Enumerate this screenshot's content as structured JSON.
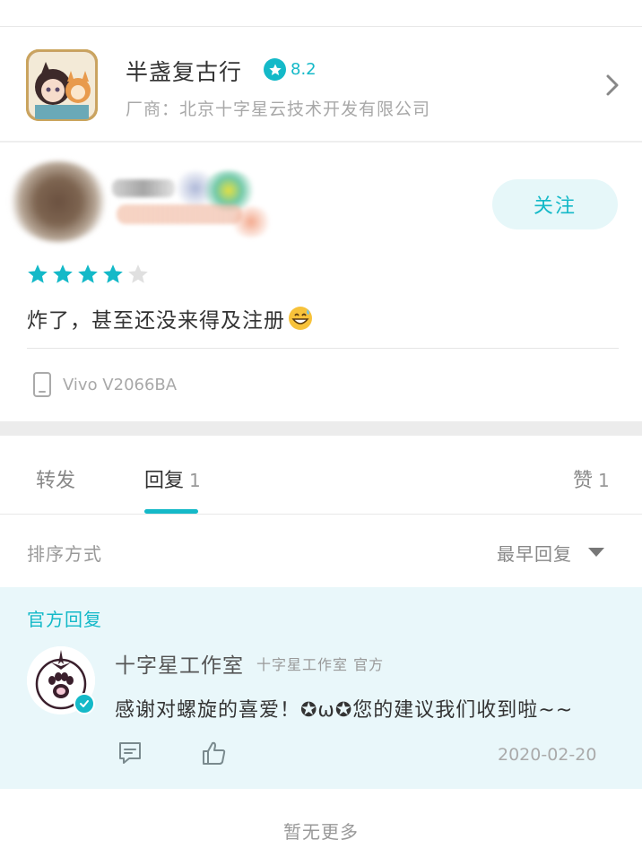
{
  "game": {
    "title": "半盏复古行",
    "rating": "8.2",
    "vendor": "厂商：北京十字星云技术开发有限公司",
    "icon": "game-avatar-icon"
  },
  "reviewer": {
    "follow_label": "关注",
    "stars_filled": 4,
    "stars_total": 5,
    "review_text": "炸了，甚至还没来得及注册",
    "emoji": "grinning-sweat-emoji"
  },
  "device": {
    "icon": "phone-icon",
    "label": "Vivo V2066BA"
  },
  "tabs": [
    {
      "label": "转发",
      "count": ""
    },
    {
      "label": "回复",
      "count": "1"
    },
    {
      "label": "赞",
      "count": "1"
    }
  ],
  "sort": {
    "label": "排序方式",
    "value": "最早回复"
  },
  "official_reply": {
    "section_title": "官方回复",
    "author": "十字星工作室",
    "author_sub": "十字星工作室 官方",
    "text": "感谢对螺旋的喜爱！✪ω✪您的建议我们收到啦~~",
    "date": "2020-02-20"
  },
  "footer": {
    "no_more": "暂无更多"
  },
  "colors": {
    "accent": "#14b9c8",
    "official_bg": "#e9f7fa",
    "follow_bg": "#e6f7f9"
  }
}
